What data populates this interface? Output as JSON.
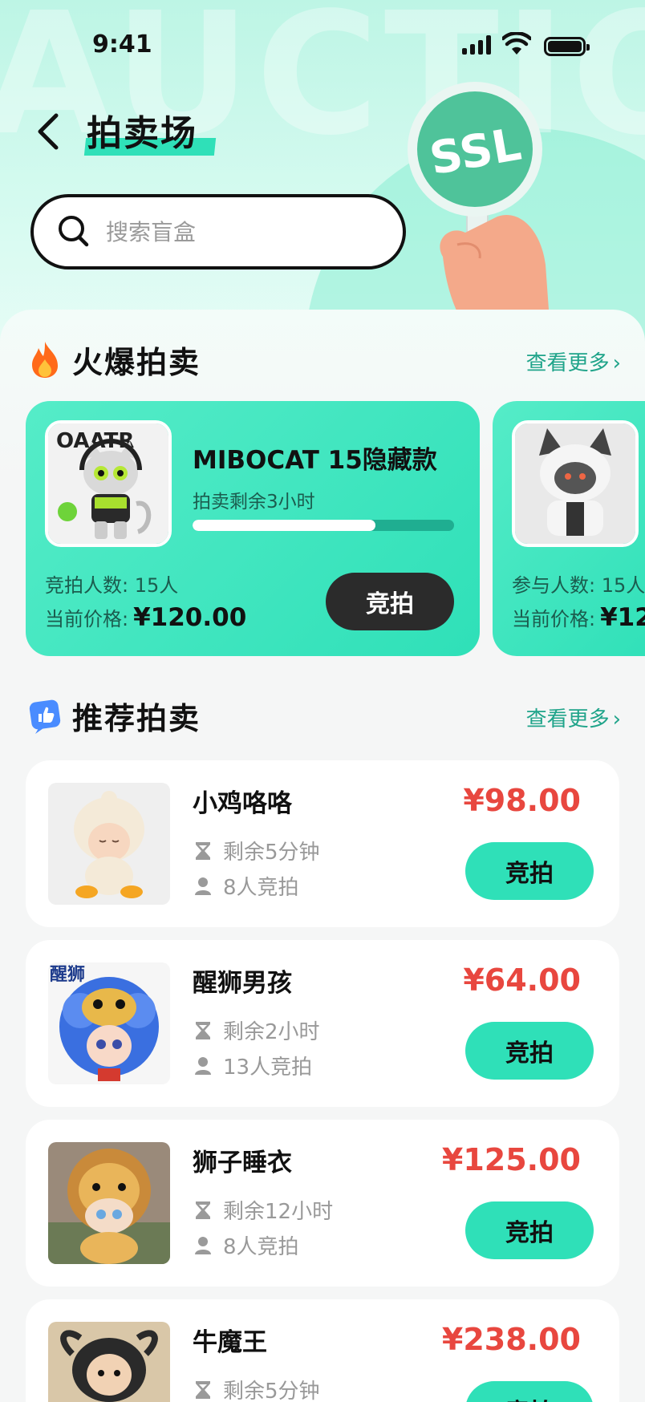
{
  "status_bar": {
    "time": "9:41"
  },
  "header": {
    "title": "拍卖场",
    "background_word": "AUCTION",
    "paddle_label": "SSL",
    "search": {
      "placeholder": "搜索盲盒"
    }
  },
  "hot_section": {
    "title": "火爆拍卖",
    "more": "查看更多",
    "cards": [
      {
        "name": "MIBOCAT 15隐藏款",
        "remaining": "拍卖剩余3小时",
        "progress": 0.7,
        "participants_label": "竞拍人数:",
        "participants": "15人",
        "price_label": "当前价格:",
        "price": "¥120.00",
        "bid_label": "竞拍"
      },
      {
        "participants_label": "参与人数:",
        "participants": "15人",
        "price_label": "当前价格:",
        "price": "¥12"
      }
    ]
  },
  "rec_section": {
    "title": "推荐拍卖",
    "more": "查看更多",
    "items": [
      {
        "name": "小鸡咯咯",
        "time_left": "剩余5分钟",
        "bidders": "8人竞拍",
        "price": "¥98.00",
        "bid_label": "竞拍"
      },
      {
        "name": "醒狮男孩",
        "time_left": "剩余2小时",
        "bidders": "13人竞拍",
        "price": "¥64.00",
        "bid_label": "竞拍"
      },
      {
        "name": "狮子睡衣",
        "time_left": "剩余12小时",
        "bidders": "8人竞拍",
        "price": "¥125.00",
        "bid_label": "竞拍"
      },
      {
        "name": "牛魔王",
        "time_left": "剩余5分钟",
        "bidders": "",
        "price": "¥238.00",
        "bid_label": "竞拍"
      }
    ]
  },
  "colors": {
    "accent": "#2fe0b8",
    "price_red": "#e8473f",
    "link_green": "#20a48a",
    "dark_button": "#2b2b2b"
  }
}
